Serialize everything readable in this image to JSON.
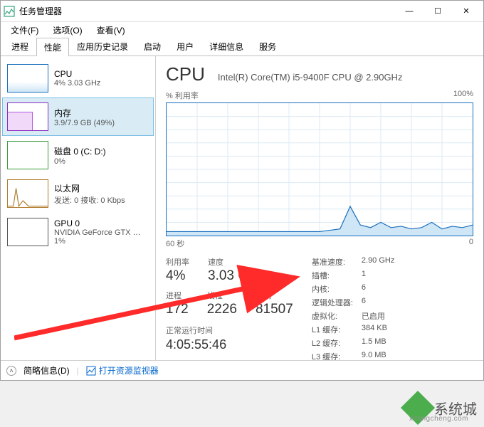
{
  "window": {
    "title": "任务管理器"
  },
  "menu": {
    "file": "文件(F)",
    "options": "选项(O)",
    "view": "查看(V)"
  },
  "tabs": [
    "进程",
    "性能",
    "应用历史记录",
    "启动",
    "用户",
    "详细信息",
    "服务"
  ],
  "activeTab": "性能",
  "sidebar": {
    "items": [
      {
        "name": "CPU",
        "sub": "4% 3.03 GHz"
      },
      {
        "name": "内存",
        "sub": "3.9/7.9 GB (49%)"
      },
      {
        "name": "磁盘 0 (C: D:)",
        "sub": "0%"
      },
      {
        "name": "以太网",
        "sub": "发送: 0 接收: 0 Kbps"
      },
      {
        "name": "GPU 0",
        "sub": "NVIDIA GeForce GTX …",
        "sub2": "1%"
      }
    ]
  },
  "cpu": {
    "title": "CPU",
    "model": "Intel(R) Core(TM) i5-9400F CPU @ 2.90GHz",
    "util_label": "% 利用率",
    "util_max": "100%",
    "x_left": "60 秒",
    "x_right": "0",
    "metrics": {
      "util_lbl": "利用率",
      "util_val": "4%",
      "speed_lbl": "速度",
      "speed_val": "3.03 GHz",
      "proc_lbl": "进程",
      "proc_val": "172",
      "threads_lbl": "线程",
      "threads_val": "2226",
      "handles_lbl": "句柄",
      "handles_val": "81507",
      "uptime_lbl": "正常运行时间",
      "uptime_val": "4:05:55:46"
    },
    "kv": {
      "base_k": "基准速度:",
      "base_v": "2.90 GHz",
      "sockets_k": "插槽:",
      "sockets_v": "1",
      "cores_k": "内核:",
      "cores_v": "6",
      "lp_k": "逻辑处理器:",
      "lp_v": "6",
      "virt_k": "虚拟化:",
      "virt_v": "已启用",
      "l1_k": "L1 缓存:",
      "l1_v": "384 KB",
      "l2_k": "L2 缓存:",
      "l2_v": "1.5 MB",
      "l3_k": "L3 缓存:",
      "l3_v": "9.0 MB"
    }
  },
  "statusbar": {
    "fewer": "简略信息(D)",
    "resmon": "打开资源监视器"
  },
  "chart_data": {
    "type": "line",
    "title": "% 利用率",
    "xlabel": "秒",
    "ylabel": "% 利用率",
    "xlim": [
      60,
      0
    ],
    "ylim": [
      0,
      100
    ],
    "x": [
      60,
      58,
      56,
      54,
      52,
      50,
      48,
      46,
      44,
      42,
      40,
      38,
      36,
      34,
      32,
      30,
      28,
      26,
      24,
      22,
      20,
      18,
      16,
      14,
      12,
      10,
      8,
      6,
      4,
      2,
      0
    ],
    "values": [
      3,
      3,
      3,
      3,
      3,
      3,
      3,
      3,
      3,
      3,
      3,
      3,
      3,
      3,
      3,
      3,
      4,
      5,
      22,
      8,
      6,
      10,
      6,
      7,
      5,
      6,
      10,
      5,
      7,
      6,
      8
    ]
  },
  "watermark": {
    "brand": "系统城",
    "url": "xitongcheng.com"
  }
}
